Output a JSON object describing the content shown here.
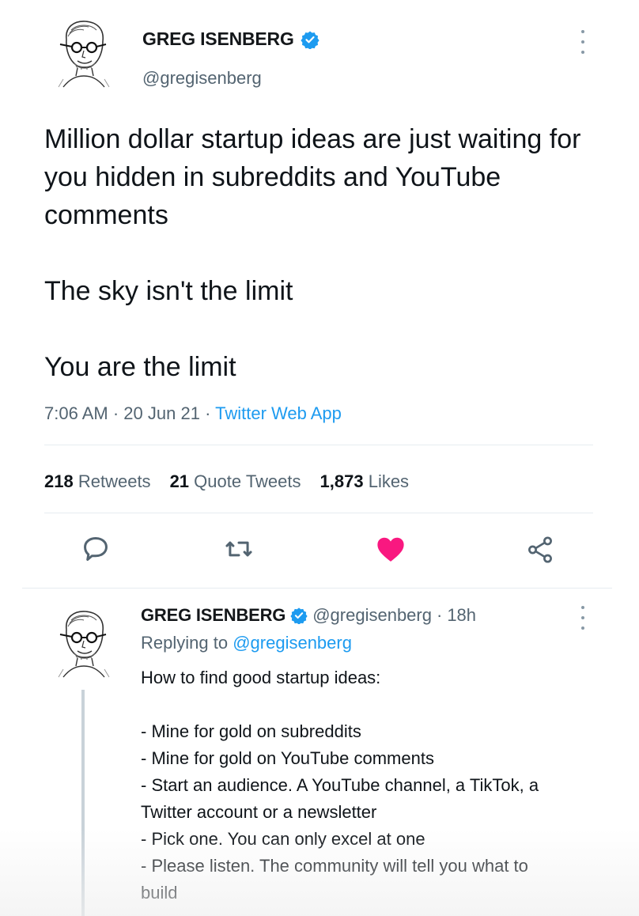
{
  "main_tweet": {
    "author_name": "GREG ISENBERG",
    "handle": "@gregisenberg",
    "paragraphs": [
      "Million dollar startup ideas are just waiting for you hidden in subreddits and YouTube comments",
      "The sky isn't the limit",
      "You are the limit"
    ],
    "time": "7:06 AM",
    "date": "20 Jun 21",
    "separator": "·",
    "source_app": "Twitter Web App",
    "stats": [
      {
        "count": "218",
        "label": "Retweets"
      },
      {
        "count": "21",
        "label": "Quote Tweets"
      },
      {
        "count": "1,873",
        "label": "Likes"
      }
    ],
    "actions": [
      "reply-icon",
      "retweet-icon",
      "like-icon",
      "share-icon"
    ]
  },
  "reply_tweet": {
    "author_name": "GREG ISENBERG",
    "handle": "@gregisenberg",
    "age": "18h",
    "separator": "·",
    "replying_to_prefix": "Replying to",
    "replying_to_handle": "@gregisenberg",
    "lines": [
      "How to find good startup ideas:",
      "",
      "- Mine for gold on subreddits",
      "- Mine for gold on YouTube comments",
      "- Start an audience. A YouTube channel, a TikTok, a",
      "Twitter account or a newsletter",
      "- Pick one. You can only excel at one",
      "- Please listen. The community will tell you what to",
      "build"
    ]
  },
  "colors": {
    "verified": "#1d9bf0",
    "like": "#f91880",
    "link": "#1d9bf0",
    "secondary_text": "#536471"
  }
}
